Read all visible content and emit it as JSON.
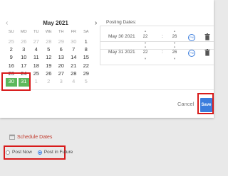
{
  "calendar": {
    "month_label": "May 2021",
    "weekdays": [
      "SU",
      "MO",
      "TU",
      "WE",
      "TH",
      "FR",
      "SA"
    ],
    "days": [
      {
        "d": "25",
        "muted": true
      },
      {
        "d": "26",
        "muted": true
      },
      {
        "d": "27",
        "muted": true
      },
      {
        "d": "28",
        "muted": true
      },
      {
        "d": "29",
        "muted": true
      },
      {
        "d": "30",
        "muted": true
      },
      {
        "d": "1",
        "muted": false
      },
      {
        "d": "2",
        "muted": false
      },
      {
        "d": "3",
        "muted": false
      },
      {
        "d": "4",
        "muted": false
      },
      {
        "d": "5",
        "muted": false
      },
      {
        "d": "6",
        "muted": false
      },
      {
        "d": "7",
        "muted": false
      },
      {
        "d": "8",
        "muted": false
      },
      {
        "d": "9",
        "muted": false
      },
      {
        "d": "10",
        "muted": false
      },
      {
        "d": "11",
        "muted": false
      },
      {
        "d": "12",
        "muted": false
      },
      {
        "d": "13",
        "muted": false
      },
      {
        "d": "14",
        "muted": false
      },
      {
        "d": "15",
        "muted": false
      },
      {
        "d": "16",
        "muted": false
      },
      {
        "d": "17",
        "muted": false
      },
      {
        "d": "18",
        "muted": false
      },
      {
        "d": "19",
        "muted": false
      },
      {
        "d": "20",
        "muted": false
      },
      {
        "d": "21",
        "muted": false
      },
      {
        "d": "22",
        "muted": false
      },
      {
        "d": "23",
        "muted": false
      },
      {
        "d": "24",
        "muted": false
      },
      {
        "d": "25",
        "muted": false
      },
      {
        "d": "26",
        "muted": false
      },
      {
        "d": "27",
        "muted": false
      },
      {
        "d": "28",
        "muted": false
      },
      {
        "d": "29",
        "muted": false
      },
      {
        "d": "30",
        "muted": false,
        "selected": true
      },
      {
        "d": "31",
        "muted": false,
        "selected": true
      },
      {
        "d": "1",
        "muted": true
      },
      {
        "d": "2",
        "muted": true
      },
      {
        "d": "3",
        "muted": true
      },
      {
        "d": "4",
        "muted": true
      },
      {
        "d": "5",
        "muted": true
      }
    ]
  },
  "posting": {
    "title": "Posting Dates:",
    "rows": [
      {
        "date": "May 30 2021",
        "hour": "22",
        "minute": "26",
        "ampm": "PM"
      },
      {
        "date": "May 31 2021",
        "hour": "22",
        "minute": "26",
        "ampm": "PM"
      }
    ]
  },
  "footer": {
    "cancel_label": "Cancel",
    "save_label": "Save"
  },
  "schedule": {
    "title": "Schedule Dates",
    "options": [
      {
        "label": "Post Now",
        "checked": false
      },
      {
        "label": "Post in Future",
        "checked": true
      }
    ]
  },
  "colors": {
    "accent": "#3b7ddd",
    "selected_day": "#5cb85c",
    "highlight": "#d81b1b",
    "schedule_title": "#c0392b"
  }
}
